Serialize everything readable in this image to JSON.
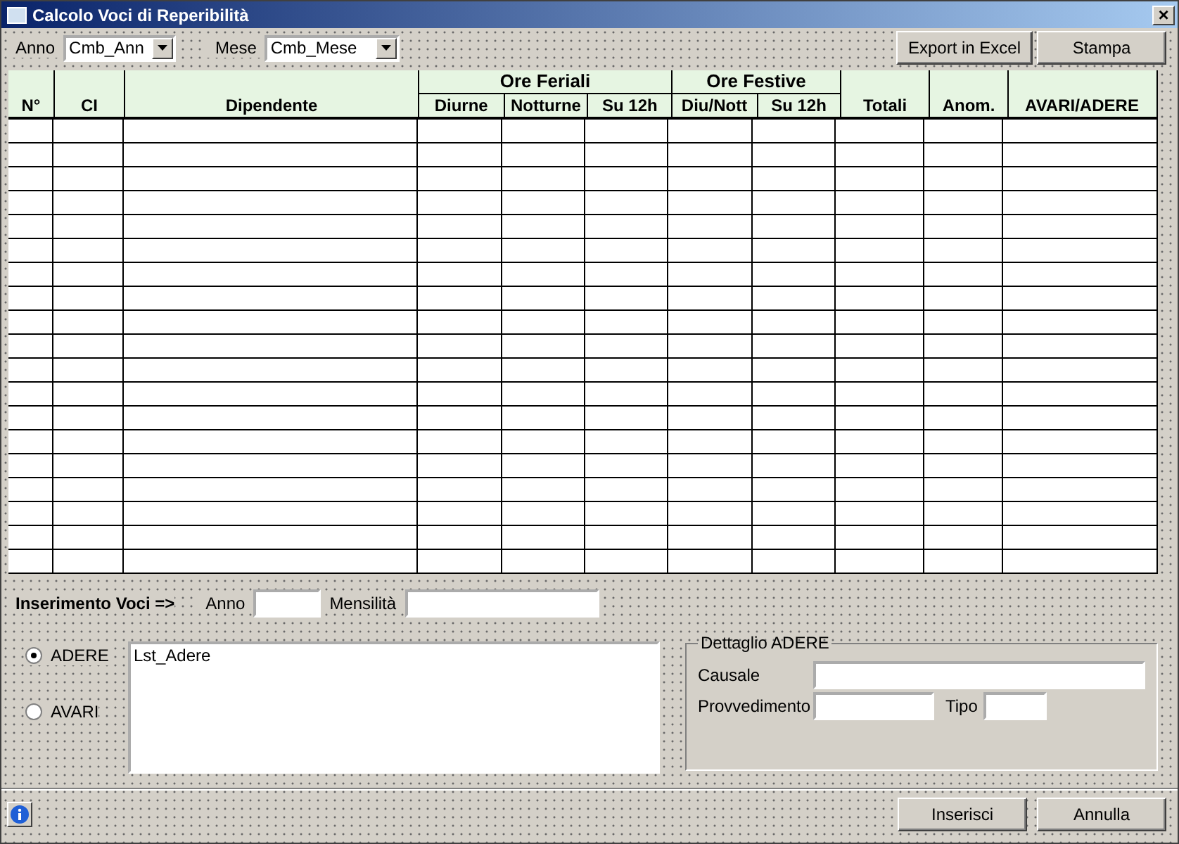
{
  "window": {
    "title": "Calcolo Voci di Reperibilità",
    "close": "×"
  },
  "filters": [
    {
      "label": "Anno",
      "value": "Cmb_Ann",
      "kind": "short"
    },
    {
      "label": "Mese",
      "value": "Cmb_Mese",
      "kind": "long"
    }
  ],
  "top_buttons": [
    "Export in Excel",
    "Stampa"
  ],
  "table": {
    "headers": [
      {
        "label": "N°"
      },
      {
        "label": "CI"
      },
      {
        "label": "Dipendente"
      },
      {
        "label": "Ore Feriali",
        "columns": [
          "Diurne",
          "Notturne",
          "Su 12h"
        ]
      },
      {
        "label": "Ore Festive",
        "columns": [
          "Diu/Nott",
          "Su 12h"
        ]
      },
      {
        "label": "Totali"
      },
      {
        "label": "Anom."
      },
      {
        "label": "AVARI/ADERE"
      }
    ]
  },
  "entry": {
    "title": "Inserimento Voci =>",
    "fields": [
      {
        "label": "Anno",
        "kind": "short"
      },
      {
        "label": "Mensilità",
        "kind": "long"
      }
    ]
  },
  "options": [
    {
      "label": "ADERE",
      "selected": true
    },
    {
      "label": "AVARI",
      "selected": false
    }
  ],
  "list": {
    "items": [
      "Lst_Adere"
    ]
  },
  "detail": {
    "title": "Dettaglio ADERE",
    "causale_label": "Causale",
    "provvedimento_label": "Provvedimento",
    "tipo_label": "Tipo"
  },
  "bottom_buttons": [
    "Inserisci",
    "Annulla"
  ]
}
